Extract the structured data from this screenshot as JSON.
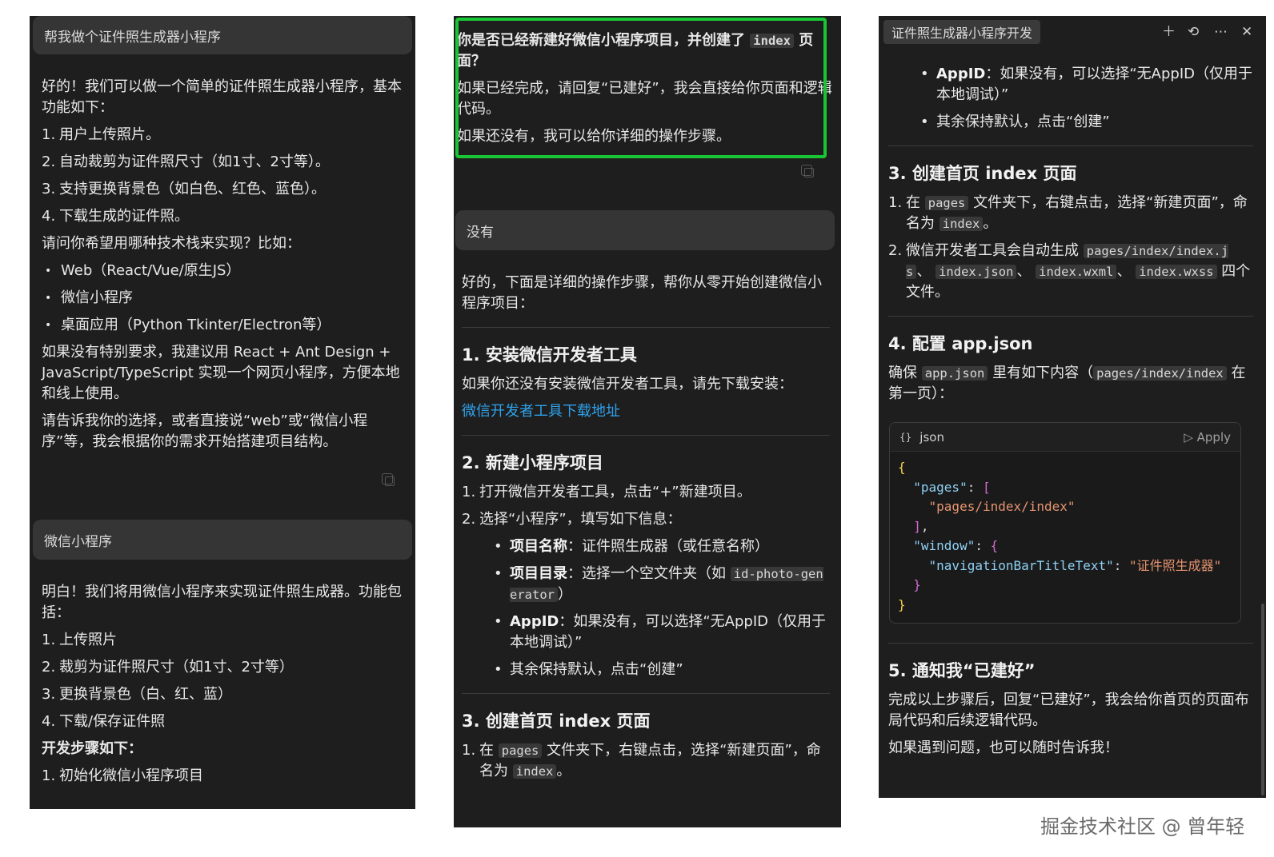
{
  "panel1": {
    "user_msg_1": "帮我做个证件照生成器小程序",
    "reply1": {
      "intro": "好的！我们可以做一个简单的证件照生成器小程序，基本功能如下：",
      "features": [
        "用户上传照片。",
        "自动裁剪为证件照尺寸（如1寸、2寸等）。",
        "支持更换背景色（如白色、红色、蓝色）。",
        "下载生成的证件照。"
      ],
      "ask": "请问你希望用哪种技术栈来实现？比如：",
      "options": [
        "Web（React/Vue/原生JS）",
        "微信小程序",
        "桌面应用（Python Tkinter/Electron等）"
      ],
      "suggest": "如果没有特别要求，我建议用 React + Ant Design + JavaScript/TypeScript 实现一个网页小程序，方便本地和线上使用。",
      "closing": "请告诉我你的选择，或者直接说“web”或“微信小程序”等，我会根据你的需求开始搭建项目结构。"
    },
    "user_msg_2": "微信小程序",
    "reply2": {
      "intro": "明白！我们将用微信小程序来实现证件照生成器。功能包括：",
      "features": [
        "上传照片",
        "裁剪为证件照尺寸（如1寸、2寸等）",
        "更换背景色（白、红、蓝）",
        "下载/保存证件照"
      ],
      "steps_title": "开发步骤如下：",
      "steps": [
        "初始化微信小程序项目"
      ]
    }
  },
  "panel2": {
    "top": {
      "q_prefix": "你是否已经新建好微信小程序项目，并创建了",
      "q_code": "index",
      "q_suffix": "页面？",
      "l1": "如果已经完成，请回复“已建好”，我会直接给你页面和逻辑代码。",
      "l2": "如果还没有，我可以给你详细的操作步骤。"
    },
    "user_msg": "没有",
    "intro": "好的，下面是详细的操作步骤，帮你从零开始创建微信小程序项目：",
    "s1_title": "1. 安装微信开发者工具",
    "s1_text": "如果你还没有安装微信开发者工具，请先下载安装：",
    "s1_link": "微信开发者工具下载地址",
    "s2_title": "2. 新建小程序项目",
    "s2_li1": "打开微信开发者工具，点击“+”新建项目。",
    "s2_li2": "选择“小程序”，填写如下信息：",
    "b1_k": "项目名称",
    "b1_v": "：证件照生成器（或任意名称）",
    "b2_k": "项目目录",
    "b2_v": "：选择一个空文件夹（如",
    "b2_code": "id-photo-generator",
    "b2_end": "）",
    "b3_k": "AppID",
    "b3_v": "：如果没有，可以选择“无AppID（仅用于本地调试）”",
    "b4": "其余保持默认，点击“创建”",
    "s3_title": "3. 创建首页 index 页面",
    "s3_a": "在",
    "s3_code1": "pages",
    "s3_b": "文件夹下，右键点击，选择“新建页面”，命名为",
    "s3_code2": "index",
    "s3_c": "。"
  },
  "panel3": {
    "tab": "证件照生成器小程序开发",
    "icons": [
      "plus-icon",
      "history-icon",
      "more-icon",
      "close-icon"
    ],
    "b3_k": "AppID",
    "b3_v": "：如果没有，可以选择“无AppID（仅用于本地调试）”",
    "b4": "其余保持默认，点击“创建”",
    "s3_title": "3. 创建首页 index 页面",
    "s3_li1_a": "在",
    "s3_li1_code1": "pages",
    "s3_li1_b": "文件夹下，右键点击，选择“新建页面”，命名为",
    "s3_li1_code2": "index",
    "s3_li1_c": "。",
    "s3_li2_a": "微信开发者工具会自动生成",
    "s3_li2_code1": "pages/index/index.js",
    "s3_li2_sep1": "、",
    "s3_li2_code2": "index.json",
    "s3_li2_sep2": "、",
    "s3_li2_code3": "index.wxml",
    "s3_li2_sep3": "、",
    "s3_li2_code4": "index.wxss",
    "s3_li2_b": "四个文件。",
    "s4_title": "4. 配置 app.json",
    "s4_a": "确保",
    "s4_code1": "app.json",
    "s4_b": "里有如下内容（",
    "s4_code2": "pages/index/index",
    "s4_c": "在第一页）：",
    "code_lang": "json",
    "apply": "Apply",
    "code": {
      "k_pages": "\"pages\"",
      "v_page": "\"pages/index/index\"",
      "k_window": "\"window\"",
      "k_nav": "\"navigationBarTitleText\"",
      "v_nav": "\"证件照生成器\""
    },
    "s5_title": "5. 通知我“已建好”",
    "s5_text": "完成以上步骤后，回复“已建好”，我会给你首页的页面布局代码和后续逻辑代码。",
    "s5_end": "如果遇到问题，也可以随时告诉我！"
  },
  "watermark": "掘金技术社区 @ 曾年轻"
}
